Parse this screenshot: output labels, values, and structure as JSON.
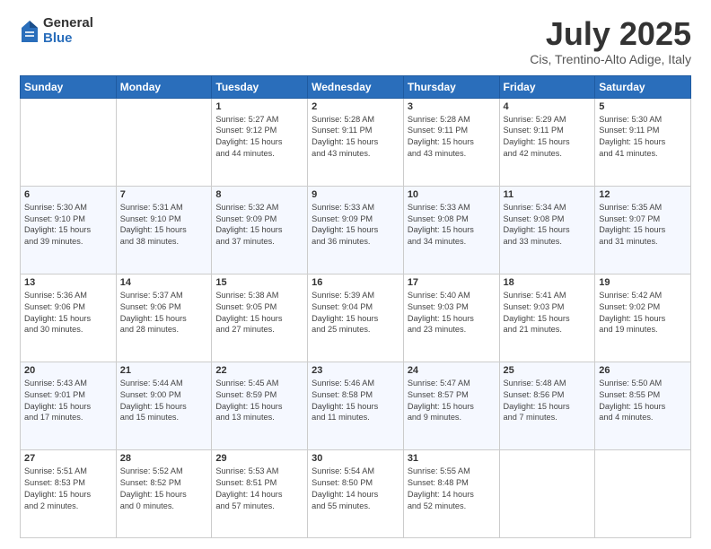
{
  "logo": {
    "general": "General",
    "blue": "Blue"
  },
  "header": {
    "title": "July 2025",
    "subtitle": "Cis, Trentino-Alto Adige, Italy"
  },
  "calendar": {
    "days_of_week": [
      "Sunday",
      "Monday",
      "Tuesday",
      "Wednesday",
      "Thursday",
      "Friday",
      "Saturday"
    ],
    "weeks": [
      [
        {
          "day": "",
          "info": ""
        },
        {
          "day": "",
          "info": ""
        },
        {
          "day": "1",
          "info": "Sunrise: 5:27 AM\nSunset: 9:12 PM\nDaylight: 15 hours\nand 44 minutes."
        },
        {
          "day": "2",
          "info": "Sunrise: 5:28 AM\nSunset: 9:11 PM\nDaylight: 15 hours\nand 43 minutes."
        },
        {
          "day": "3",
          "info": "Sunrise: 5:28 AM\nSunset: 9:11 PM\nDaylight: 15 hours\nand 43 minutes."
        },
        {
          "day": "4",
          "info": "Sunrise: 5:29 AM\nSunset: 9:11 PM\nDaylight: 15 hours\nand 42 minutes."
        },
        {
          "day": "5",
          "info": "Sunrise: 5:30 AM\nSunset: 9:11 PM\nDaylight: 15 hours\nand 41 minutes."
        }
      ],
      [
        {
          "day": "6",
          "info": "Sunrise: 5:30 AM\nSunset: 9:10 PM\nDaylight: 15 hours\nand 39 minutes."
        },
        {
          "day": "7",
          "info": "Sunrise: 5:31 AM\nSunset: 9:10 PM\nDaylight: 15 hours\nand 38 minutes."
        },
        {
          "day": "8",
          "info": "Sunrise: 5:32 AM\nSunset: 9:09 PM\nDaylight: 15 hours\nand 37 minutes."
        },
        {
          "day": "9",
          "info": "Sunrise: 5:33 AM\nSunset: 9:09 PM\nDaylight: 15 hours\nand 36 minutes."
        },
        {
          "day": "10",
          "info": "Sunrise: 5:33 AM\nSunset: 9:08 PM\nDaylight: 15 hours\nand 34 minutes."
        },
        {
          "day": "11",
          "info": "Sunrise: 5:34 AM\nSunset: 9:08 PM\nDaylight: 15 hours\nand 33 minutes."
        },
        {
          "day": "12",
          "info": "Sunrise: 5:35 AM\nSunset: 9:07 PM\nDaylight: 15 hours\nand 31 minutes."
        }
      ],
      [
        {
          "day": "13",
          "info": "Sunrise: 5:36 AM\nSunset: 9:06 PM\nDaylight: 15 hours\nand 30 minutes."
        },
        {
          "day": "14",
          "info": "Sunrise: 5:37 AM\nSunset: 9:06 PM\nDaylight: 15 hours\nand 28 minutes."
        },
        {
          "day": "15",
          "info": "Sunrise: 5:38 AM\nSunset: 9:05 PM\nDaylight: 15 hours\nand 27 minutes."
        },
        {
          "day": "16",
          "info": "Sunrise: 5:39 AM\nSunset: 9:04 PM\nDaylight: 15 hours\nand 25 minutes."
        },
        {
          "day": "17",
          "info": "Sunrise: 5:40 AM\nSunset: 9:03 PM\nDaylight: 15 hours\nand 23 minutes."
        },
        {
          "day": "18",
          "info": "Sunrise: 5:41 AM\nSunset: 9:03 PM\nDaylight: 15 hours\nand 21 minutes."
        },
        {
          "day": "19",
          "info": "Sunrise: 5:42 AM\nSunset: 9:02 PM\nDaylight: 15 hours\nand 19 minutes."
        }
      ],
      [
        {
          "day": "20",
          "info": "Sunrise: 5:43 AM\nSunset: 9:01 PM\nDaylight: 15 hours\nand 17 minutes."
        },
        {
          "day": "21",
          "info": "Sunrise: 5:44 AM\nSunset: 9:00 PM\nDaylight: 15 hours\nand 15 minutes."
        },
        {
          "day": "22",
          "info": "Sunrise: 5:45 AM\nSunset: 8:59 PM\nDaylight: 15 hours\nand 13 minutes."
        },
        {
          "day": "23",
          "info": "Sunrise: 5:46 AM\nSunset: 8:58 PM\nDaylight: 15 hours\nand 11 minutes."
        },
        {
          "day": "24",
          "info": "Sunrise: 5:47 AM\nSunset: 8:57 PM\nDaylight: 15 hours\nand 9 minutes."
        },
        {
          "day": "25",
          "info": "Sunrise: 5:48 AM\nSunset: 8:56 PM\nDaylight: 15 hours\nand 7 minutes."
        },
        {
          "day": "26",
          "info": "Sunrise: 5:50 AM\nSunset: 8:55 PM\nDaylight: 15 hours\nand 4 minutes."
        }
      ],
      [
        {
          "day": "27",
          "info": "Sunrise: 5:51 AM\nSunset: 8:53 PM\nDaylight: 15 hours\nand 2 minutes."
        },
        {
          "day": "28",
          "info": "Sunrise: 5:52 AM\nSunset: 8:52 PM\nDaylight: 15 hours\nand 0 minutes."
        },
        {
          "day": "29",
          "info": "Sunrise: 5:53 AM\nSunset: 8:51 PM\nDaylight: 14 hours\nand 57 minutes."
        },
        {
          "day": "30",
          "info": "Sunrise: 5:54 AM\nSunset: 8:50 PM\nDaylight: 14 hours\nand 55 minutes."
        },
        {
          "day": "31",
          "info": "Sunrise: 5:55 AM\nSunset: 8:48 PM\nDaylight: 14 hours\nand 52 minutes."
        },
        {
          "day": "",
          "info": ""
        },
        {
          "day": "",
          "info": ""
        }
      ]
    ]
  }
}
